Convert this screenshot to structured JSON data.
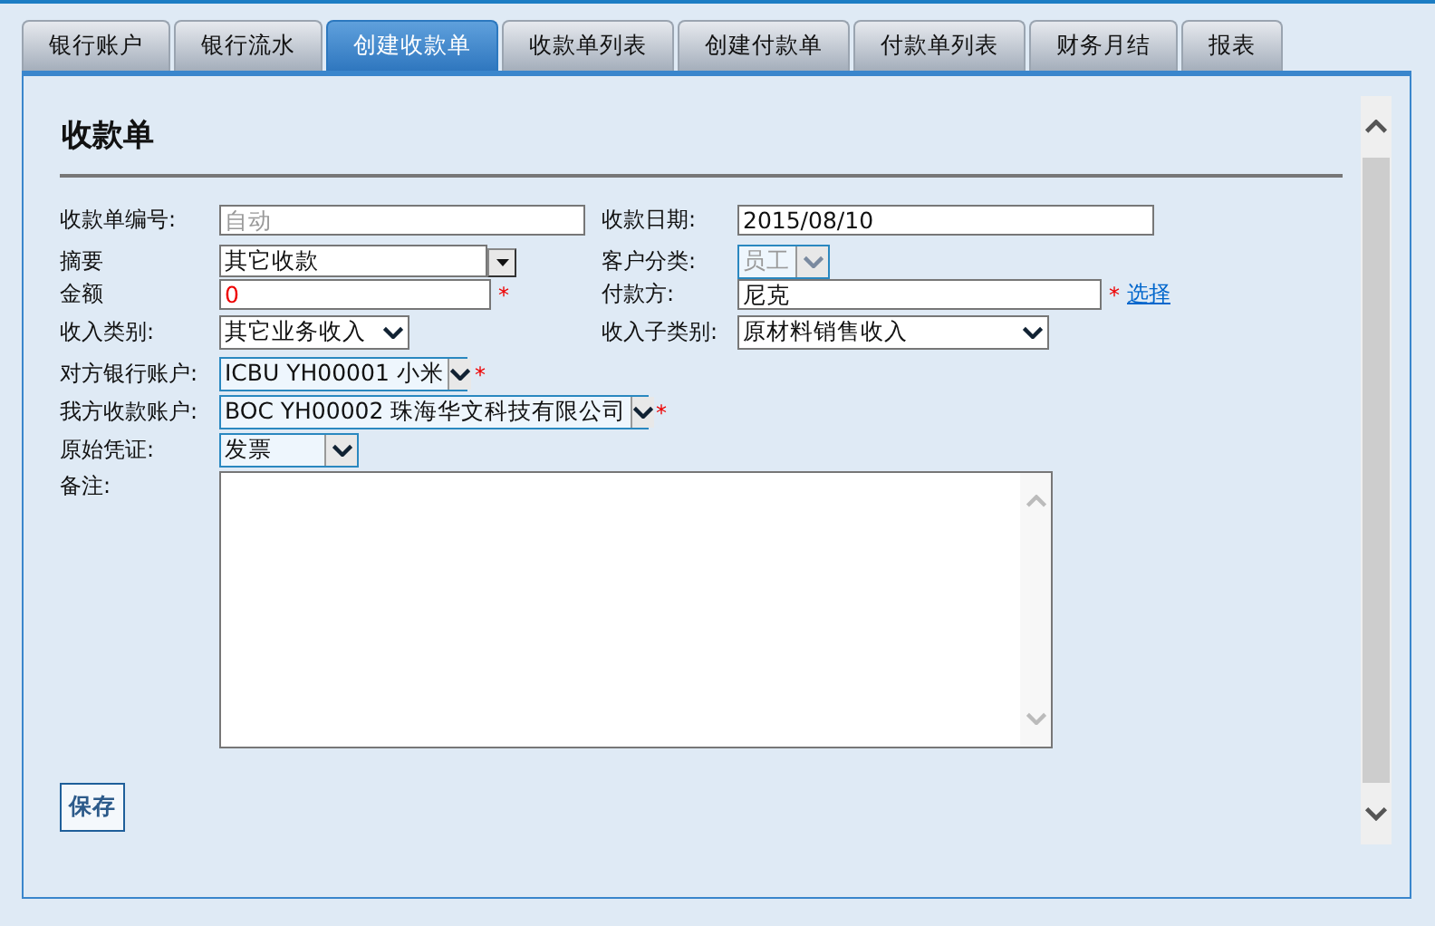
{
  "tabs": [
    {
      "label": "银行账户",
      "selected": false
    },
    {
      "label": "银行流水",
      "selected": false
    },
    {
      "label": "创建收款单",
      "selected": true
    },
    {
      "label": "收款单列表",
      "selected": false
    },
    {
      "label": "创建付款单",
      "selected": false
    },
    {
      "label": "付款单列表",
      "selected": false
    },
    {
      "label": "财务月结",
      "selected": false
    },
    {
      "label": "报表",
      "selected": false
    }
  ],
  "form": {
    "title": "收款单",
    "rows": [
      {
        "left": {
          "label": "收款单编号:",
          "kind": "text",
          "value": "自动",
          "disabled": true
        },
        "right": {
          "label": "收款日期:",
          "kind": "text",
          "value": "2015/08/10",
          "disabled": false
        }
      },
      {
        "left": {
          "label": "摘要",
          "kind": "combo",
          "value": "其它收款",
          "disabled": false
        },
        "right": {
          "label": "客户分类:",
          "kind": "select",
          "value": "员工",
          "disabled": true
        }
      },
      {
        "left": {
          "label": "金额",
          "kind": "text",
          "value": "0",
          "disabled": false,
          "mark": "*"
        },
        "right": {
          "label": "付款方:",
          "kind": "text",
          "value": "尼克",
          "disabled": false,
          "mark": "*",
          "link": "选择"
        }
      },
      {
        "left": {
          "label": "收入类别:",
          "kind": "select",
          "value": "其它业务收入",
          "disabled": false
        },
        "right": {
          "label": "收入子类别:",
          "kind": "select",
          "value": "原材料销售收入",
          "disabled": false
        }
      },
      {
        "left": {
          "label": "对方银行账户:",
          "kind": "select",
          "value": "ICBU YH00001 小米",
          "disabled": false,
          "mark": "*"
        }
      },
      {
        "left": {
          "label": "我方收款账户:",
          "kind": "select",
          "value": "BOC YH00002 珠海华文科技有限公司",
          "disabled": false,
          "mark": "*"
        }
      },
      {
        "left": {
          "label": "原始凭证:",
          "kind": "select",
          "value": "发票",
          "disabled": false
        }
      },
      {
        "left": {
          "label": "备注:",
          "kind": "textarea",
          "disabled": false
        }
      }
    ],
    "button": "保存"
  }
}
